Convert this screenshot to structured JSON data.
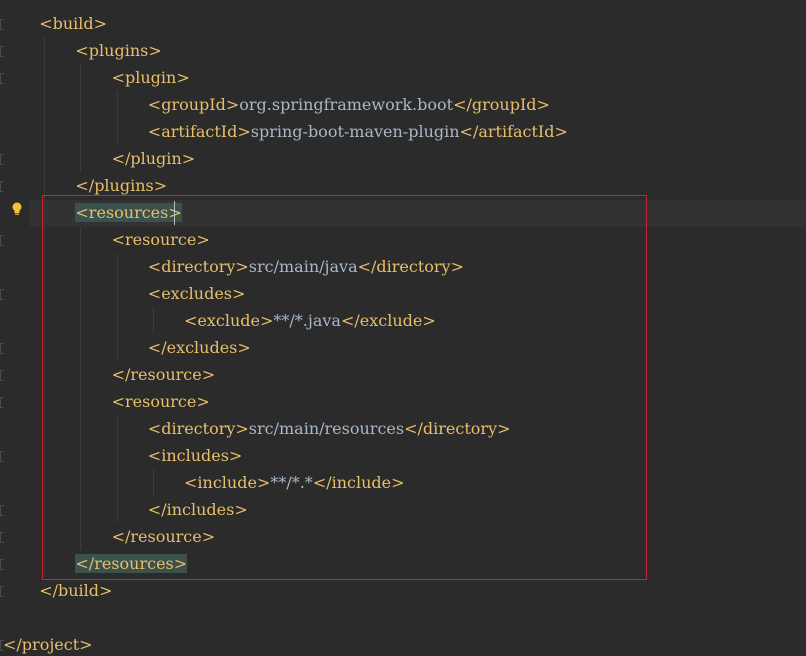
{
  "editor": {
    "lines": [
      {
        "indent": 1,
        "tag": "build",
        "kind": "open"
      },
      {
        "indent": 2,
        "tag": "plugins",
        "kind": "open"
      },
      {
        "indent": 3,
        "tag": "plugin",
        "kind": "open"
      },
      {
        "indent": 4,
        "tag": "groupId",
        "kind": "element",
        "value": "org.springframework.boot"
      },
      {
        "indent": 4,
        "tag": "artifactId",
        "kind": "element",
        "value": "spring-boot-maven-plugin"
      },
      {
        "indent": 3,
        "tag": "plugin",
        "kind": "close"
      },
      {
        "indent": 2,
        "tag": "plugins",
        "kind": "close"
      },
      {
        "indent": 2,
        "tag": "resources",
        "kind": "open",
        "highlighted": true,
        "current": true
      },
      {
        "indent": 3,
        "tag": "resource",
        "kind": "open"
      },
      {
        "indent": 4,
        "tag": "directory",
        "kind": "element",
        "value": "src/main/java"
      },
      {
        "indent": 4,
        "tag": "excludes",
        "kind": "open"
      },
      {
        "indent": 5,
        "tag": "exclude",
        "kind": "element",
        "value": "**/*.java"
      },
      {
        "indent": 4,
        "tag": "excludes",
        "kind": "close"
      },
      {
        "indent": 3,
        "tag": "resource",
        "kind": "close"
      },
      {
        "indent": 3,
        "tag": "resource",
        "kind": "open"
      },
      {
        "indent": 4,
        "tag": "directory",
        "kind": "element",
        "value": "src/main/resources"
      },
      {
        "indent": 4,
        "tag": "includes",
        "kind": "open"
      },
      {
        "indent": 5,
        "tag": "include",
        "kind": "element",
        "value": "**/*.*"
      },
      {
        "indent": 4,
        "tag": "includes",
        "kind": "close"
      },
      {
        "indent": 3,
        "tag": "resource",
        "kind": "close"
      },
      {
        "indent": 2,
        "tag": "resources",
        "kind": "close",
        "highlighted": true
      },
      {
        "indent": 1,
        "tag": "build",
        "kind": "close"
      },
      {
        "indent": 0,
        "tag": "",
        "kind": "blank"
      },
      {
        "indent": 0,
        "tag": "project",
        "kind": "close"
      }
    ],
    "gutter_icon": "lightbulb-icon"
  },
  "colors": {
    "background": "#2b2b2b",
    "tag": "#e8bf6a",
    "text": "#a9b7c6",
    "match_highlight": "#3b514d",
    "annotation_box": "#c8242b",
    "bulb": "#f0c23a"
  }
}
